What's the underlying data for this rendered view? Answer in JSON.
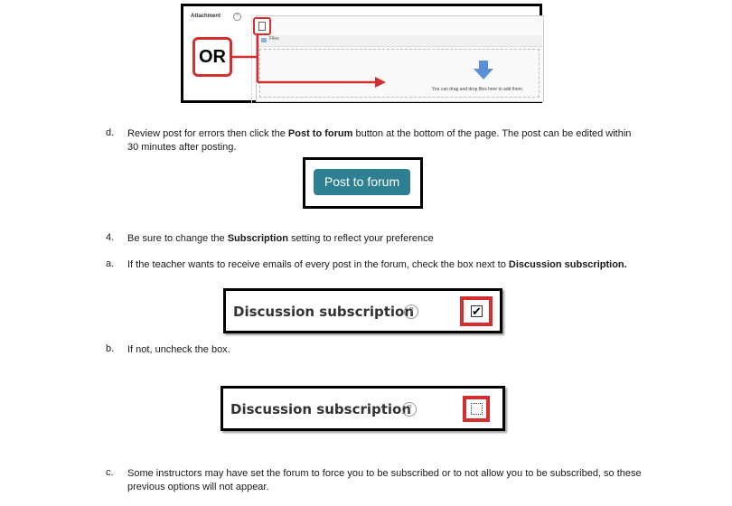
{
  "figure1": {
    "attachment_label": "Attachment",
    "help": "?",
    "files_label": "Files",
    "drop_text": "You can drag and drop files here to add them.",
    "or_label": "OR",
    "icons": [
      "add-file-icon",
      "folder-icon",
      "down-arrow-icon",
      "help-icon"
    ],
    "accent_red": "#d32f2f"
  },
  "step_d": {
    "marker": "d.",
    "text_before": "Review post for errors then click the ",
    "bold": "Post to forum",
    "text_after": " button at the bottom of the page. The post can be edited within",
    "line2": "30 minutes after posting."
  },
  "post_button": {
    "label": "Post to forum",
    "color": "#2f7f93"
  },
  "step_4": {
    "marker": "4.",
    "text_before": "Be sure to change the ",
    "bold": "Subscription",
    "text_after": " setting to reflect your preference"
  },
  "step_a": {
    "marker": "a.",
    "text_before": "If the teacher wants to receive emails of every post in the forum, check the box next to ",
    "bold": "Discussion subscription."
  },
  "subscription_checked": {
    "label": "Discussion subscription",
    "help": "?",
    "checked": true,
    "check_glyph": "✔"
  },
  "step_b": {
    "marker": "b.",
    "text": "If not, uncheck the box."
  },
  "subscription_unchecked": {
    "label": "Discussion subscription",
    "help": "?",
    "checked": false
  },
  "step_c": {
    "marker": "c.",
    "line1": "Some instructors may have set the forum to force you to be subscribed or to not allow you to be subscribed, so these",
    "line2": "previous options will not appear."
  }
}
